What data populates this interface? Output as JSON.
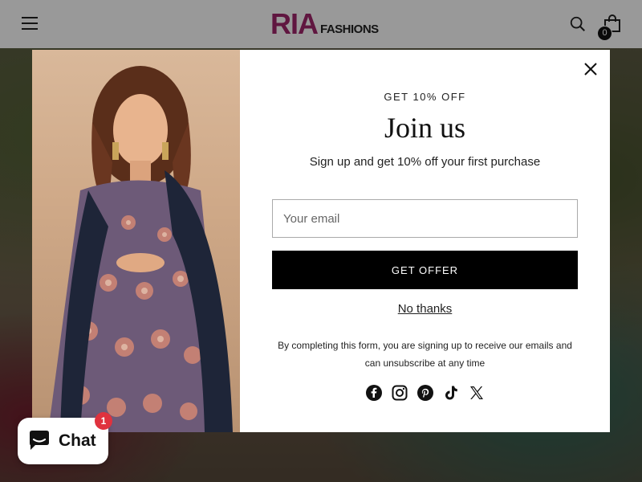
{
  "header": {
    "logo_main": "RIA",
    "logo_sub": "FASHIONS",
    "cart_count": "0"
  },
  "modal": {
    "eyebrow": "GET 10% OFF",
    "title": "Join us",
    "subtitle": "Sign up and get 10% off your first purchase",
    "email_placeholder": "Your email",
    "email_value": "",
    "submit_label": "GET OFFER",
    "dismiss_label": "No thanks",
    "disclaimer": "By completing this form, you are signing up to receive our emails and can unsubscribe at any time",
    "socials": [
      "facebook-icon",
      "instagram-icon",
      "pinterest-icon",
      "tiktok-icon",
      "x-icon"
    ]
  },
  "chat": {
    "label": "Chat",
    "badge": "1"
  },
  "colors": {
    "brand": "#a0256a",
    "button": "#000000",
    "chat_badge": "#e0323e"
  }
}
